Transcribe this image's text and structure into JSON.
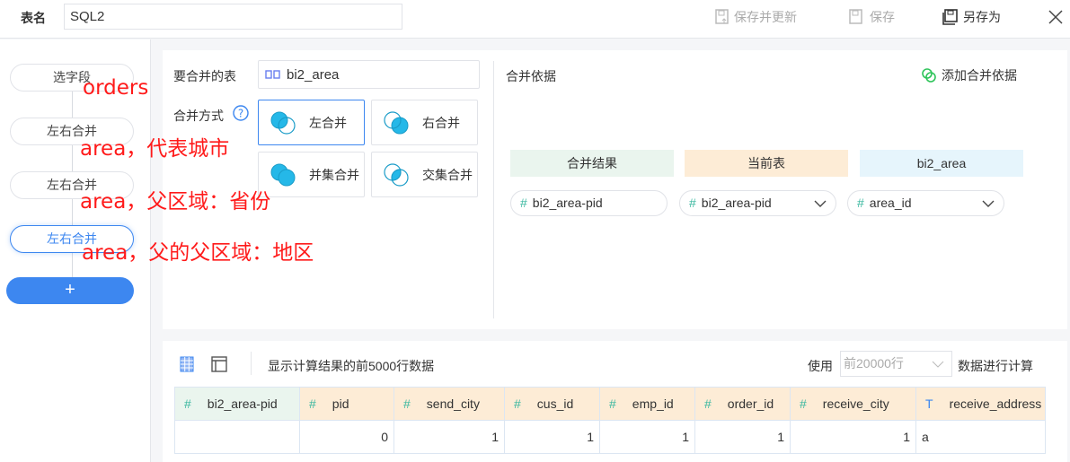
{
  "header": {
    "table_name_label": "表名",
    "table_name_value": "SQL2",
    "save_update": "保存并更新",
    "save": "保存",
    "save_as": "另存为"
  },
  "sidebar": {
    "nodes": [
      "选字段",
      "左右合并",
      "左右合并",
      "左右合并"
    ],
    "selected_index": 3,
    "add": "+"
  },
  "annotations": [
    "orders",
    "area，代表城市",
    "area，父区域：省份",
    "area，父的父区域：地区"
  ],
  "merge": {
    "table_label": "要合并的表",
    "table_value": "bi2_area",
    "method_label": "合并方式",
    "methods": [
      "左合并",
      "右合并",
      "并集合并",
      "交集合并"
    ],
    "selected_method": "左合并",
    "basis_label": "合并依据",
    "add_basis": "添加合并依据",
    "columns": {
      "result": "合并结果",
      "current": "当前表",
      "other": "bi2_area"
    },
    "row": {
      "result": "bi2_area-pid",
      "current": "bi2_area-pid",
      "other": "area_id"
    },
    "colors": {
      "result": "#eaf5ee",
      "current": "#fdecd6",
      "other": "#e6f5fc"
    }
  },
  "preview": {
    "info": "显示计算结果的前5000行数据",
    "use_label": "使用",
    "rows_select": "前20000行",
    "compute_label": "数据进行计算",
    "columns": [
      {
        "name": "bi2_area-pid",
        "type": "#"
      },
      {
        "name": "pid",
        "type": "#"
      },
      {
        "name": "send_city",
        "type": "#"
      },
      {
        "name": "cus_id",
        "type": "#"
      },
      {
        "name": "emp_id",
        "type": "#"
      },
      {
        "name": "order_id",
        "type": "#"
      },
      {
        "name": "receive_city",
        "type": "#"
      },
      {
        "name": "receive_address",
        "type": "T"
      }
    ],
    "rows": [
      [
        "",
        "0",
        "1",
        "1",
        "1",
        "1",
        "1",
        "a"
      ]
    ]
  }
}
